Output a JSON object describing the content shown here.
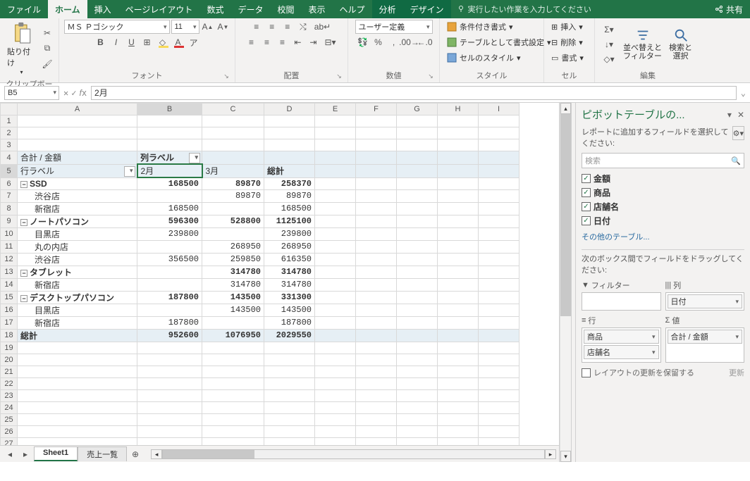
{
  "tabs": [
    "ファイル",
    "ホーム",
    "挿入",
    "ページレイアウト",
    "数式",
    "データ",
    "校閲",
    "表示",
    "ヘルプ",
    "分析",
    "デザイン"
  ],
  "tellme": "実行したい作業を入力してください",
  "share": "共有",
  "ribbon": {
    "clipboard": {
      "paste": "貼り付け",
      "label": "クリップボード"
    },
    "font": {
      "name": "ＭＳ Ｐゴシック",
      "size": "11",
      "label": "フォント",
      "b": "B",
      "i": "I",
      "u": "U"
    },
    "align": {
      "label": "配置",
      "wrap": "ab"
    },
    "number": {
      "format": "ユーザー定義",
      "label": "数値"
    },
    "styles": {
      "cond": "条件付き書式",
      "table": "テーブルとして書式設定",
      "cell": "セルのスタイル",
      "label": "スタイル"
    },
    "cells": {
      "insert": "挿入",
      "delete": "削除",
      "format": "書式",
      "label": "セル"
    },
    "editing": {
      "sort": "並べ替えと\nフィルター",
      "find": "検索と\n選択",
      "label": "編集"
    }
  },
  "name_box": "B5",
  "formula": "2月",
  "columns": [
    "A",
    "B",
    "C",
    "D",
    "E",
    "F",
    "G",
    "H",
    "I"
  ],
  "pivot": {
    "a4": "合計 / 金額",
    "b4": "列ラベル",
    "a5": "行ラベル",
    "b5": "2月",
    "c5": "3月",
    "d5": "総計",
    "rows": [
      {
        "r": 6,
        "label": "SSD",
        "lv": 0,
        "v": [
          "168500",
          "89870",
          "258370"
        ]
      },
      {
        "r": 7,
        "label": "渋谷店",
        "lv": 1,
        "v": [
          "",
          "89870",
          "89870"
        ]
      },
      {
        "r": 8,
        "label": "新宿店",
        "lv": 1,
        "v": [
          "168500",
          "",
          "168500"
        ]
      },
      {
        "r": 9,
        "label": "ノートパソコン",
        "lv": 0,
        "v": [
          "596300",
          "528800",
          "1125100"
        ]
      },
      {
        "r": 10,
        "label": "目黒店",
        "lv": 1,
        "v": [
          "239800",
          "",
          "239800"
        ]
      },
      {
        "r": 11,
        "label": "丸の内店",
        "lv": 1,
        "v": [
          "",
          "268950",
          "268950"
        ]
      },
      {
        "r": 12,
        "label": "渋谷店",
        "lv": 1,
        "v": [
          "356500",
          "259850",
          "616350"
        ]
      },
      {
        "r": 13,
        "label": "タブレット",
        "lv": 0,
        "v": [
          "",
          "314780",
          "314780"
        ]
      },
      {
        "r": 14,
        "label": "新宿店",
        "lv": 1,
        "v": [
          "",
          "314780",
          "314780"
        ]
      },
      {
        "r": 15,
        "label": "デスクトップパソコン",
        "lv": 0,
        "v": [
          "187800",
          "143500",
          "331300"
        ]
      },
      {
        "r": 16,
        "label": "目黒店",
        "lv": 1,
        "v": [
          "",
          "143500",
          "143500"
        ]
      },
      {
        "r": 17,
        "label": "新宿店",
        "lv": 1,
        "v": [
          "187800",
          "",
          "187800"
        ]
      }
    ],
    "total": {
      "label": "総計",
      "v": [
        "952600",
        "1076950",
        "2029550"
      ]
    }
  },
  "sheets": [
    "Sheet1",
    "売上一覧"
  ],
  "pane": {
    "title": "ピボットテーブルの...",
    "desc": "レポートに追加するフィールドを選択してください:",
    "search": "検索",
    "fields": [
      "金額",
      "商品",
      "店舗名",
      "日付"
    ],
    "other": "その他のテーブル...",
    "drag": "次のボックス間でフィールドをドラッグしてください:",
    "boxes": {
      "filter": "フィルター",
      "col": "列",
      "row": "行",
      "val": "値"
    },
    "chips": {
      "col": [
        "日付"
      ],
      "row": [
        "商品",
        "店舗名"
      ],
      "val": [
        "合計 / 金額"
      ]
    },
    "defer": "レイアウトの更新を保留する",
    "update": "更新"
  }
}
